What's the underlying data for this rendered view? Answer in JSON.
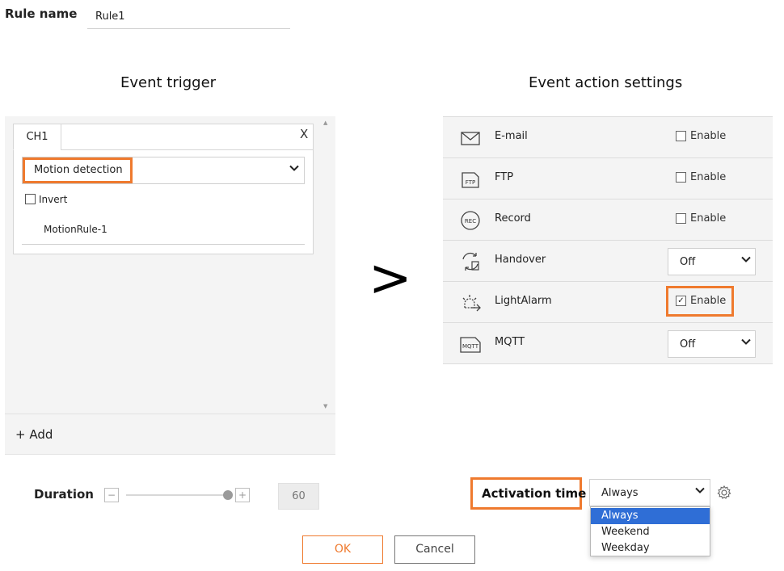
{
  "rule": {
    "label": "Rule name",
    "value": "Rule1"
  },
  "event_trigger": {
    "title": "Event trigger",
    "tab": "CH1",
    "close": "X",
    "detection": "Motion detection",
    "invert_label": "Invert",
    "invert_checked": false,
    "rules": [
      "MotionRule-1"
    ],
    "add_label": "+ Add"
  },
  "arrow": ">",
  "event_action": {
    "title": "Event action settings",
    "rows": [
      {
        "name": "E-mail",
        "icon": "envelope-icon",
        "control": "checkbox",
        "label": "Enable",
        "checked": false
      },
      {
        "name": "FTP",
        "icon": "ftp-icon",
        "control": "checkbox",
        "label": "Enable",
        "checked": false
      },
      {
        "name": "Record",
        "icon": "record-icon",
        "control": "checkbox",
        "label": "Enable",
        "checked": false
      },
      {
        "name": "Handover",
        "icon": "handover-icon",
        "control": "select",
        "value": "Off"
      },
      {
        "name": "LightAlarm",
        "icon": "light-alarm-icon",
        "control": "checkbox",
        "label": "Enable",
        "checked": true
      },
      {
        "name": "MQTT",
        "icon": "mqtt-icon",
        "control": "select",
        "value": "Off"
      }
    ],
    "checkmark": "✓"
  },
  "duration": {
    "label": "Duration",
    "value": "60",
    "minus": "−",
    "plus": "+"
  },
  "activation": {
    "label": "Activation time",
    "value": "Always",
    "options": [
      "Always",
      "Weekend",
      "Weekday"
    ]
  },
  "buttons": {
    "ok": "OK",
    "cancel": "Cancel"
  },
  "colors": {
    "highlight": "#ef7a2e",
    "dropdown_selected": "#2f6ed6"
  }
}
